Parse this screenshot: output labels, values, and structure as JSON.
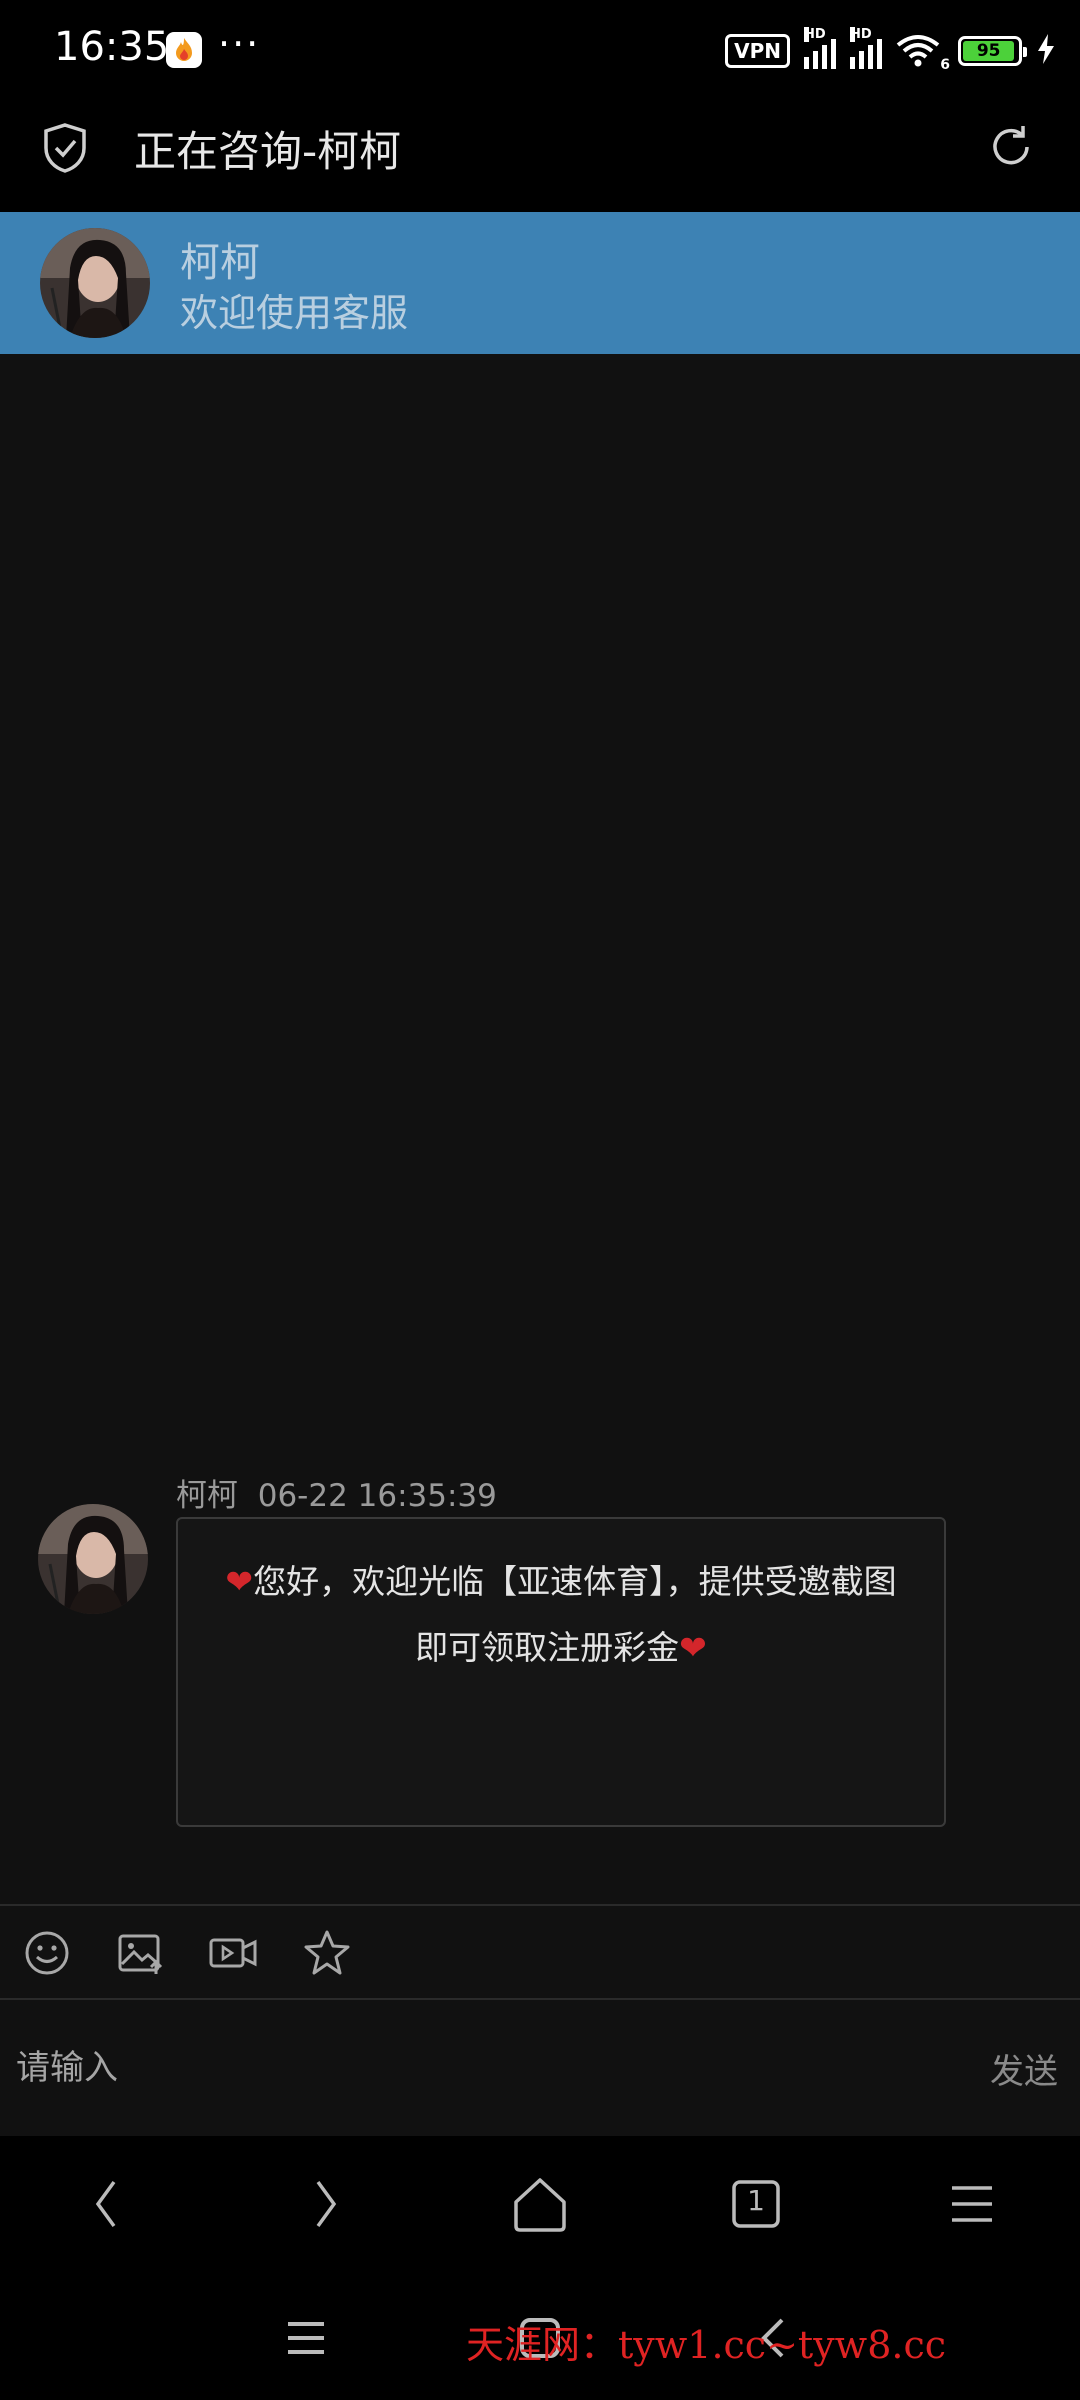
{
  "status_bar": {
    "time": "16:35",
    "dots": "···",
    "vpn": "VPN",
    "hd1": "HD",
    "hd2": "HD",
    "wifi_gen": "6",
    "battery": "95",
    "battery_level_percent": 95,
    "battery_color": "#4cd13a"
  },
  "title_bar": {
    "title": "正在咨询-柯柯",
    "left_icon": "shield-check-icon",
    "right_icon": "refresh-icon"
  },
  "agent_header": {
    "name": "柯柯",
    "subtitle": "欢迎使用客服",
    "background": "#3d82b4"
  },
  "messages": [
    {
      "sender": "柯柯",
      "timestamp": "06-22 16:35:39",
      "text_line1": "您好，欢迎光临【亚速体育】，提供受邀截图",
      "text_line2": "即可领取注册彩金",
      "heart": "❤"
    }
  ],
  "toolbar": {
    "icons": [
      "emoji-icon",
      "image-upload-icon",
      "video-icon",
      "star-icon"
    ]
  },
  "input": {
    "placeholder": "请输入",
    "value": "",
    "send_label": "发送"
  },
  "browser_nav": {
    "icons": [
      "back-icon",
      "forward-icon",
      "home-icon",
      "tabs-icon",
      "menu-icon"
    ],
    "tab_count": "1"
  },
  "system_nav": {
    "icons": [
      "menu-icon",
      "home-icon",
      "back-icon"
    ]
  },
  "watermark": "天涯网：tyw1.cc~tyw8.cc"
}
